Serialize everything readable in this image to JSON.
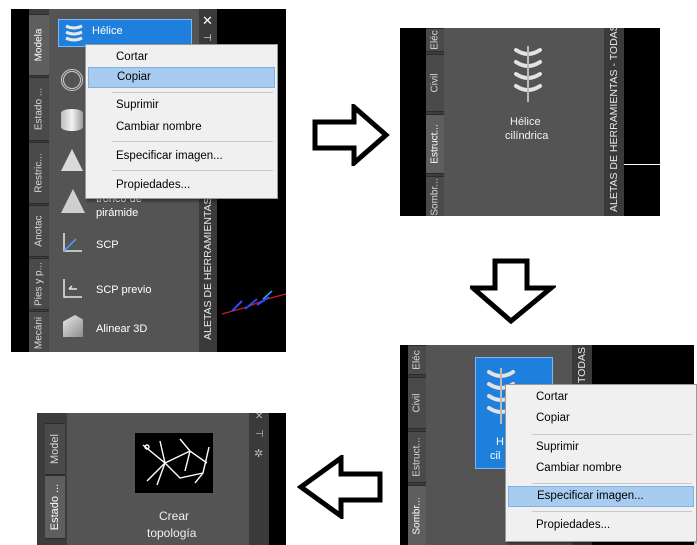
{
  "context_menu": {
    "items": [
      "Cortar",
      "Copiar",
      "Suprimir",
      "Cambiar nombre",
      "Especificar imagen...",
      "Propiedades..."
    ]
  },
  "panel1": {
    "tabs": [
      "Modela",
      "Estado ...",
      "Restric...",
      "Anotac",
      "Pies y p...",
      "Mecáni"
    ],
    "selected_tool": "Hélice",
    "tools": [
      "tronco de",
      "pirámide",
      "SCP",
      "SCP previo",
      "Alinear 3D"
    ],
    "palette_title": "ALETAS DE HERRAMIENTAS -"
  },
  "panel2": {
    "tabs": [
      "Eléc",
      "Civil",
      "Estruct...",
      "Sombr..."
    ],
    "tool_label_line1": "Hélice",
    "tool_label_line2": "cilíndrica",
    "palette_title": "ALETAS DE HERRAMIENTAS - TODAS"
  },
  "panel3": {
    "tabs": [
      "Eléc",
      "Civil",
      "Estruct...",
      "Sombr..."
    ],
    "tool_label_fragment1": "H",
    "tool_label_fragment2": "cil",
    "palette_title": "TODAS"
  },
  "panel4": {
    "tabs": [
      "Model",
      "Estado ..."
    ],
    "tool_label_line1": "Crear",
    "tool_label_line2": "topología"
  },
  "icons": [
    "close-icon",
    "pin-icon",
    "palette-menu-icon",
    "arrow-right-icon",
    "arrow-down-icon",
    "arrow-left-icon"
  ]
}
